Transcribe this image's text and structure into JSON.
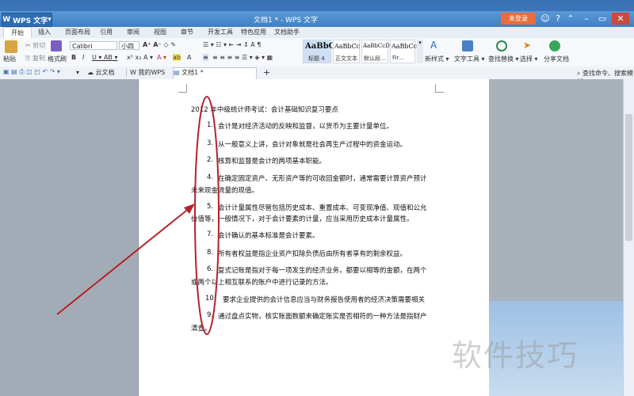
{
  "app": {
    "name": "WPS 文字",
    "doc_title": "文档1 * - WPS 文字",
    "login": "未登录"
  },
  "menu": {
    "tabs": [
      "开始",
      "插入",
      "页面布局",
      "引用",
      "审阅",
      "视图",
      "章节",
      "开发工具",
      "特色应用",
      "文档助手"
    ]
  },
  "ribbon": {
    "paste": "粘贴",
    "cut": "剪切",
    "copy": "复制",
    "format_painter": "格式刷",
    "font_name": "Calibri",
    "font_size": "小四",
    "styles": [
      {
        "preview": "AaBbC",
        "name": "标题 4"
      },
      {
        "preview": "AaBbCc",
        "name": "正文文本"
      },
      {
        "preview": "AaBbCcD",
        "name": "默认段..."
      },
      {
        "preview": "AaBbCc",
        "name": "Fir..."
      }
    ],
    "new_style": "新样式",
    "text_tools": "文字工具",
    "find_replace": "查找替换",
    "select": "选择",
    "share": "分享文档"
  },
  "tabs": {
    "cloud": "云文档",
    "mine": "我的WPS",
    "doc1": "文档1 *",
    "search_placeholder": "查找命令、搜索模板"
  },
  "document": {
    "title_line": "2012 年中级统计师考试：会计基础知识复习要点",
    "items": [
      {
        "num": "1.",
        "text": "会计是对经济活动的反映和监督，以货币为主要计量单位。",
        "cont": ""
      },
      {
        "num": "3.",
        "text": "从一般意义上讲，会计对象就是社会再生产过程中的资金运动。",
        "cont": ""
      },
      {
        "num": "2.",
        "text": "核算和监督是会计的两项基本职能。",
        "cont": ""
      },
      {
        "num": "4.",
        "text": "在确定固定资产、无形资产等的可收回金额时，通常需要计算资产预计",
        "cont": "未来现金流量的现值。"
      },
      {
        "num": "5.",
        "text": "会计计量属性尽管包括历史成本、重置成本、可变现净值、现值和公允",
        "cont": "价值等，一般情况下，对于会计要素的计量，应当采用历史成本计量属性。"
      },
      {
        "num": "7.",
        "text": "会计确认的基本标准是会计要素。",
        "cont": ""
      },
      {
        "num": "8.",
        "text": "所有者权益是指企业资产扣除负债后由所有者享有的剩余权益。",
        "cont": ""
      },
      {
        "num": "6.",
        "text": "复式记账是指对于每一项发生的经济业务，都要以相等的金额，在两个",
        "cont": "或两个以上相互联系的账户中进行记录的方法。"
      },
      {
        "num": "10.",
        "text": "要求企业提供的会计信息应当与财务报告使用者的经济决策需要相关",
        "cont": ""
      },
      {
        "num": "9.",
        "text": "通过盘点实物，核实账面数额来确定账实是否相符的一种方法是指财产",
        "cont": "清查。"
      }
    ]
  },
  "watermark": "软件技巧",
  "colors": {
    "annotation": "#b3232a",
    "title_bar": "#4a8ccc",
    "login_btn": "#e86c3c"
  }
}
